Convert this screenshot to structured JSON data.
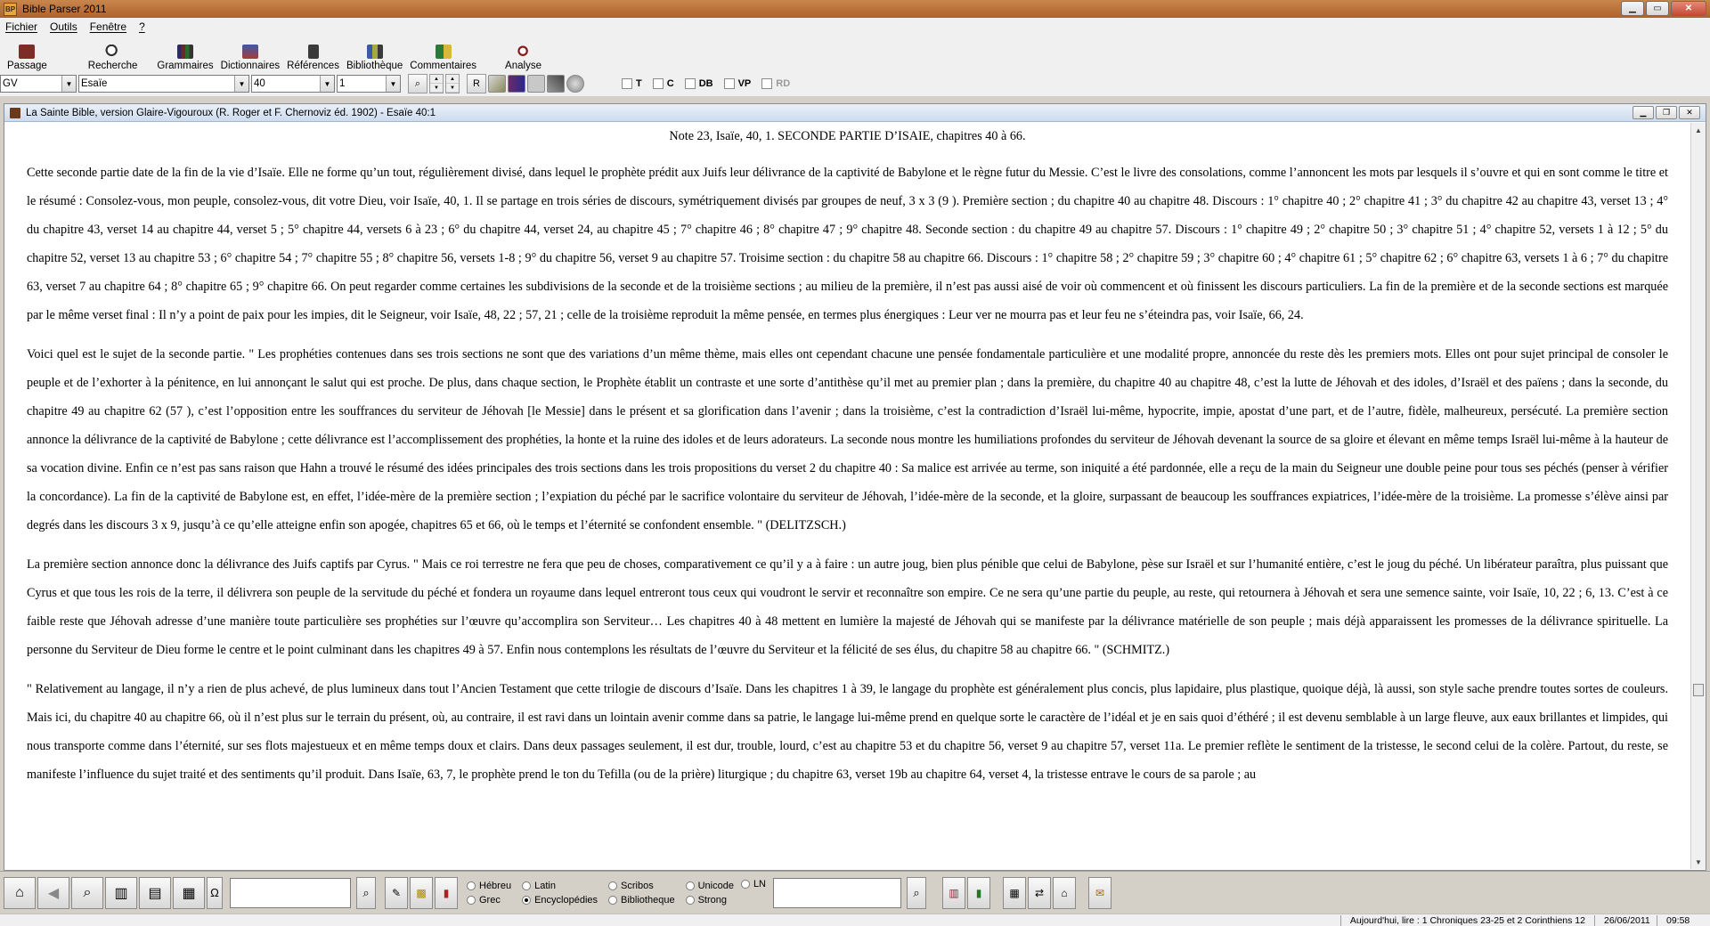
{
  "app": {
    "title": "Bible Parser 2011",
    "icon_text": "BP"
  },
  "menu": {
    "file": "Fichier",
    "tools": "Outils",
    "window": "Fenêtre",
    "help": "?"
  },
  "toolbar": {
    "buttons": [
      "Passage",
      "Recherche",
      "Grammaires",
      "Dictionnaires",
      "Références",
      "Bibliothèque",
      "Commentaires"
    ],
    "analyse": "Analyse"
  },
  "selectors": {
    "version": "GV",
    "book": "Esaïe",
    "chapter": "40",
    "verse": "1",
    "r_label": "R"
  },
  "checks": [
    "T",
    "C",
    "DB",
    "VP",
    "RD"
  ],
  "document": {
    "title": "La Sainte Bible, version Glaire-Vigouroux (R. Roger et F. Chernoviz éd. 1902) - Esaïe 40:1",
    "heading": "Note 23, Isaïe, 40, 1. SECONDE PARTIE D’ISAIE, chapitres 40 à 66.",
    "p1": "Cette seconde partie date de la fin de la vie d’Isaïe. Elle ne forme qu’un tout, régulièrement divisé, dans lequel le prophète prédit aux Juifs leur délivrance de la captivité de Babylone et le règne futur du Messie. C’est le livre des consolations, comme l’annoncent les mots par lesquels il s’ouvre et qui en sont comme le titre et le résumé : Consolez-vous, mon peuple, consolez-vous, dit votre Dieu, voir Isaïe, 40, 1. Il se partage en trois séries de discours, symétriquement divisés par groupes de neuf, 3 x 3 (9 ). Première section ; du chapitre 40 au chapitre 48. Discours : 1° chapitre 40 ; 2° chapitre 41 ; 3° du chapitre 42 au chapitre 43, verset 13 ; 4° du chapitre 43, verset 14 au chapitre 44, verset 5 ; 5° chapitre 44, versets 6 à 23 ; 6° du chapitre 44, verset 24, au chapitre 45 ; 7° chapitre 46 ; 8° chapitre 47 ; 9° chapitre 48. Seconde section : du chapitre 49 au chapitre 57. Discours : 1° chapitre 49 ; 2° chapitre 50 ; 3° chapitre 51 ; 4° chapitre 52, versets 1 à 12 ; 5° du chapitre 52, verset 13 au chapitre 53 ; 6° chapitre 54 ; 7° chapitre 55 ; 8° chapitre 56, versets 1-8 ; 9° du chapitre 56, verset 9 au chapitre 57. Troisime section : du chapitre 58 au chapitre 66. Discours : 1° chapitre 58 ; 2° chapitre 59 ; 3° chapitre 60 ; 4° chapitre 61 ; 5° chapitre 62 ; 6° chapitre 63, versets 1 à 6 ; 7° du chapitre 63, verset 7 au chapitre 64 ; 8° chapitre 65 ; 9° chapitre 66. On peut regarder comme certaines les subdivisions de la seconde et de la troisième sections ; au milieu de la première, il n’est pas aussi aisé de voir où commencent et où finissent les discours particuliers. La fin de la première et de la seconde sections est marquée par le même verset final : Il n’y a point de paix pour les impies, dit le Seigneur, voir Isaïe, 48, 22 ; 57, 21 ; celle de la troisième reproduit la même pensée, en termes plus énergiques : Leur ver ne mourra pas et leur feu ne s’éteindra pas, voir Isaïe, 66, 24.",
    "p2": "Voici quel est le sujet de la seconde partie. \" Les prophéties contenues dans ses trois sections ne sont que des variations d’un même thème, mais elles ont cependant chacune une pensée fondamentale particulière et une modalité propre, annoncée du reste dès les premiers mots. Elles ont pour sujet principal de consoler le peuple et de l’exhorter à la pénitence, en lui annonçant le salut qui est proche. De plus, dans chaque section, le Prophète établit un contraste et une sorte d’antithèse qu’il met au premier plan ; dans la première, du chapitre 40 au chapitre 48, c’est la lutte de Jéhovah et des idoles, d’Israël et des païens ; dans la seconde, du chapitre 49 au chapitre 62 (57 ), c’est l’opposition entre les souffrances du serviteur de Jéhovah [le Messie] dans le présent et sa glorification dans l’avenir ; dans la troisième, c’est la contradiction d’Israël lui-même, hypocrite, impie, apostat d’une part, et de l’autre, fidèle, malheureux, persécuté. La première section annonce la délivrance de la captivité de Babylone ; cette délivrance est l’accomplissement des prophéties, la honte et la ruine des idoles et de leurs adorateurs. La seconde nous montre les humiliations profondes du serviteur de Jéhovah devenant la source de sa gloire et élevant en même temps Israël lui-même à la hauteur de sa vocation divine. Enfin ce n’est pas sans raison que Hahn a trouvé le résumé des idées principales des trois sections dans les trois propositions du verset 2 du chapitre 40 : Sa malice est arrivée au terme, son iniquité a été pardonnée, elle a reçu de la main du Seigneur une double peine pour tous ses péchés (penser à vérifier la concordance). La fin de la captivité de Babylone est, en effet, l’idée-mère de la première section ; l’expiation du péché par le sacrifice volontaire du serviteur de Jéhovah, l’idée-mère de la seconde, et la gloire, surpassant de beaucoup les souffrances expiatrices, l’idée-mère de la troisième. La promesse s’élève ainsi par degrés dans les discours 3 x 9, jusqu’à ce qu’elle atteigne enfin son apogée, chapitres 65 et 66, où le temps et l’éternité se confondent ensemble. \" (DELITZSCH.)",
    "p3": "La première section annonce donc la délivrance des Juifs captifs par Cyrus. \" Mais ce roi terrestre ne fera que peu de choses, comparativement ce qu’il y a à faire : un autre joug, bien plus pénible que celui de Babylone, pèse sur Israël et sur l’humanité entière, c’est le joug du péché. Un libérateur paraîtra, plus puissant que Cyrus et que tous les rois de la terre, il délivrera son peuple de la servitude du péché et fondera un royaume dans lequel entreront tous ceux qui voudront le servir et reconnaître son empire. Ce ne sera qu’une partie du peuple, au reste, qui retournera à Jéhovah et sera une semence sainte, voir Isaïe, 10, 22 ; 6, 13. C’est à ce faible reste que Jéhovah adresse d’une manière toute particulière ses prophéties sur l’œuvre qu’accomplira son Serviteur… Les chapitres 40 à 48 mettent en lumière la majesté de Jéhovah qui se manifeste par la délivrance matérielle de son peuple ; mais déjà apparaissent les promesses de la délivrance spirituelle. La personne du Serviteur de Dieu forme le centre et le point culminant dans les chapitres 49 à 57. Enfin nous contemplons les résultats de l’œuvre du Serviteur et la félicité de ses élus, du chapitre 58 au chapitre 66. \" (SCHMITZ.)",
    "p4": "\" Relativement au langage, il n’y a rien de plus achevé, de plus lumineux dans tout l’Ancien Testament que cette trilogie de discours d’Isaïe. Dans les chapitres 1 à 39, le langage du prophète est généralement plus concis, plus lapidaire, plus plastique, quoique déjà, là aussi, son style sache prendre toutes sortes de couleurs. Mais ici, du chapitre 40 au chapitre 66, où il n’est plus sur le terrain du présent, où, au contraire, il est ravi dans un lointain avenir comme dans sa patrie, le langage lui-même prend en quelque sorte le caractère de l’idéal et je en sais quoi d’éthéré ; il est devenu semblable à un large fleuve, aux eaux brillantes et limpides, qui nous transporte comme dans l’éternité, sur ses flots majestueux et en même temps doux et clairs. Dans deux passages seulement, il est dur, trouble, lourd, c’est au chapitre 53 et du chapitre 56, verset 9 au chapitre 57, verset 11a. Le premier reflète le sentiment de la tristesse, le second celui de la colère. Partout, du reste, se manifeste l’influence du sujet traité et des sentiments qu’il produit. Dans Isaïe, 63, 7, le prophète prend le ton du Tefilla (ou de la prière) liturgique ; du chapitre 63, verset 19b au chapitre 64, verset 4, la tristesse entrave le cours de sa parole ; au"
  },
  "bottom": {
    "radios": [
      {
        "label": "Hébreu",
        "checked": false
      },
      {
        "label": "Latin",
        "checked": false
      },
      {
        "label": "Scribos",
        "checked": false
      },
      {
        "label": "Unicode",
        "checked": false
      },
      {
        "label": "Grec",
        "checked": false
      },
      {
        "label": "Encyclopédies",
        "checked": true
      },
      {
        "label": "Bibliotheque",
        "checked": false
      },
      {
        "label": "Strong",
        "checked": false
      }
    ],
    "ln_label": "LN"
  },
  "status": {
    "reading": "Aujourd'hui, lire : 1 Chroniques 23-25 et 2 Corinthiens 12",
    "date": "26/06/2011",
    "time": "09:58"
  }
}
